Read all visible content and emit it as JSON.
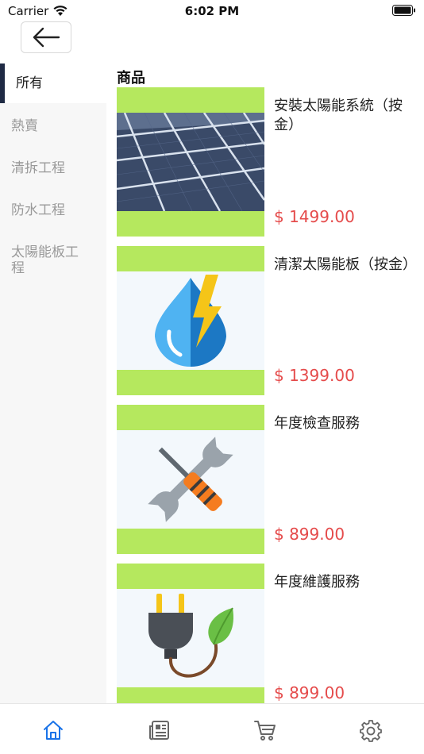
{
  "status_bar": {
    "carrier": "Carrier",
    "time": "6:02 PM"
  },
  "header": {
    "back_icon": "arrow-left-icon"
  },
  "sidebar": {
    "items": [
      {
        "label": "所有",
        "active": true
      },
      {
        "label": "熱賣",
        "active": false
      },
      {
        "label": "清拆工程",
        "active": false
      },
      {
        "label": "防水工程",
        "active": false
      },
      {
        "label": "太陽能板工程",
        "active": false
      }
    ]
  },
  "main": {
    "section_title": "商品",
    "products": [
      {
        "name": "安裝太陽能系統（按金）",
        "price": "$ 1499.00",
        "icon": "solar-panel-icon"
      },
      {
        "name": "清潔太陽能板（按金）",
        "price": "$ 1399.00",
        "icon": "water-energy-icon"
      },
      {
        "name": "年度檢查服務",
        "price": "$ 899.00",
        "icon": "tools-icon"
      },
      {
        "name": "年度維護服務",
        "price": "$ 899.00",
        "icon": "eco-plug-icon"
      }
    ]
  },
  "tab_bar": {
    "tabs": [
      {
        "icon": "home-icon",
        "active": true
      },
      {
        "icon": "news-icon",
        "active": false
      },
      {
        "icon": "cart-icon",
        "active": false
      },
      {
        "icon": "gear-icon",
        "active": false
      }
    ]
  },
  "colors": {
    "accent": "#1a73e8",
    "price": "#e54b4b",
    "thumb_bg": "#b5e85e",
    "sidebar_indicator": "#1f2a44"
  }
}
